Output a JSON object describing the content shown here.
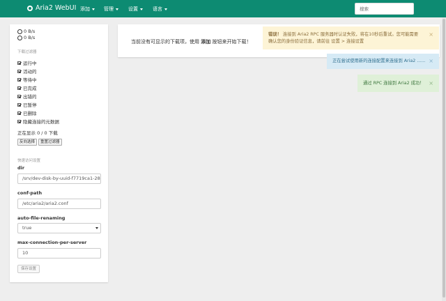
{
  "navbar": {
    "brand": "Aria2 WebUI",
    "menus": [
      "添加",
      "管理",
      "设置",
      "语言"
    ],
    "search_placeholder": "搜索"
  },
  "sidebar": {
    "download_speed": "0 B/s",
    "upload_speed": "0 B/s",
    "filter_title": "下载过滤器",
    "filters": [
      "运行中",
      "活动的",
      "等待中",
      "已完成",
      "出错的",
      "已暂停",
      "已删除",
      "隐藏连接的元数据"
    ],
    "showing_text": "正在显示 0 / 0 下载",
    "reverse_button": "反向选择",
    "reset_button": "重置过滤器",
    "quick_settings_title": "快速访问设置",
    "options": [
      {
        "label": "dir",
        "value": "/srv/dev-disk-by-uuid-f7719ca1-28("
      },
      {
        "label": "conf-path",
        "value": "/etc/aria2/aria2.conf"
      },
      {
        "label": "auto-file-renaming",
        "value": "true"
      },
      {
        "label": "max-connection-per-server",
        "value": "10"
      }
    ],
    "save_button": "保存设置"
  },
  "main": {
    "message_prefix": "当前没有可显示的下载项，使用",
    "message_strong": "添加",
    "message_suffix": "按钮来开始下载！"
  },
  "toasts": {
    "warning_title": "错误！",
    "warning_line1": "连接到 Aria2 RPC 服务器时认证失败，将在10秒后重试。您可能需要",
    "warning_line2": "确认您的身份验证信息，请前往 设置 > 连接设置",
    "info": "正在尝试使用新的连接配置来连接到 Aria2 ......",
    "success": "通过 RPC 连接到 Aria2 成功！",
    "close_glyph": "×"
  },
  "colors": {
    "navbar": "#0d8b72",
    "warning_bg": "#fdf4d6",
    "info_bg": "#d6eaf5",
    "success_bg": "#dff0d8"
  }
}
